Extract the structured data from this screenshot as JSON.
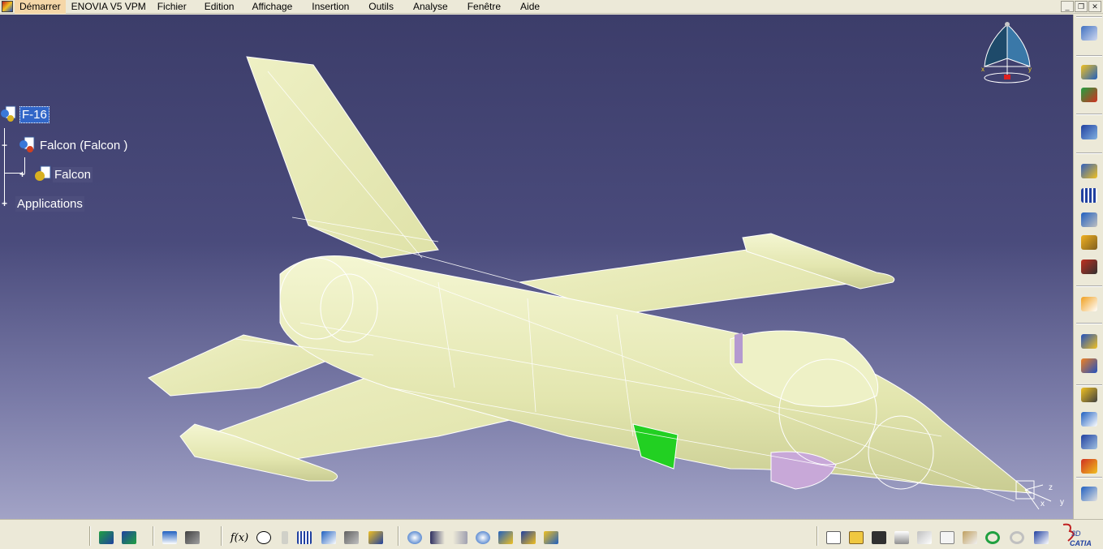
{
  "menu": {
    "start": "Démarrer",
    "items": [
      "ENOVIA V5 VPM",
      "Fichier",
      "Edition",
      "Affichage",
      "Insertion",
      "Outils",
      "Analyse",
      "Fenêtre",
      "Aide"
    ]
  },
  "window_buttons": [
    "_",
    "❐",
    "✕"
  ],
  "tree": {
    "root": "F-16",
    "child": "Falcon (Falcon )",
    "grandchild": "Falcon",
    "applications": "Applications"
  },
  "compass": {
    "x_label": "x",
    "y_label": "y"
  },
  "axis": {
    "x": "x",
    "y": "y",
    "z": "z"
  },
  "right_toolbar": {
    "icons": [
      "select-icon",
      "fly-mode-icon",
      "product-icon",
      "assembly-icon",
      "sheet-metal-icon",
      "part-icon",
      "simulation-icon",
      "catalog-icon",
      "material-icon",
      "tools-icon",
      "select-arrow-icon",
      "manipulate-icon",
      "snap-icon",
      "constraint-icon",
      "anchor-icon",
      "fix-icon",
      "update-icon",
      "measure-icon"
    ]
  },
  "bottom_toolbar": {
    "fx_label": "f(x)",
    "icons": [
      "fit-all-icon",
      "normal-view-icon",
      "measure-between-icon",
      "measure-item-icon",
      "formula-icon",
      "comment-icon",
      "lock-icon",
      "table-icon",
      "tree-icon",
      "padlock-icon",
      "parameters-icon",
      "fly-icon",
      "first-icon",
      "last-icon",
      "zoom-icon",
      "rotate-icon",
      "shading-icon",
      "hide-show-icon",
      "new-file-icon",
      "open-file-icon",
      "save-icon",
      "print-icon",
      "cut-icon",
      "copy-icon",
      "paste-icon",
      "undo-icon",
      "redo-icon",
      "help-icon"
    ]
  },
  "colors": {
    "accent": "#3166c8",
    "viewport_top": "#3c3d6a",
    "viewport_bottom": "#a2a3c6",
    "plane_body": "#e6e9b4",
    "intake_green": "#22d022",
    "tank_purple": "#c8a8d8"
  },
  "brand": {
    "name": "CATIA"
  }
}
